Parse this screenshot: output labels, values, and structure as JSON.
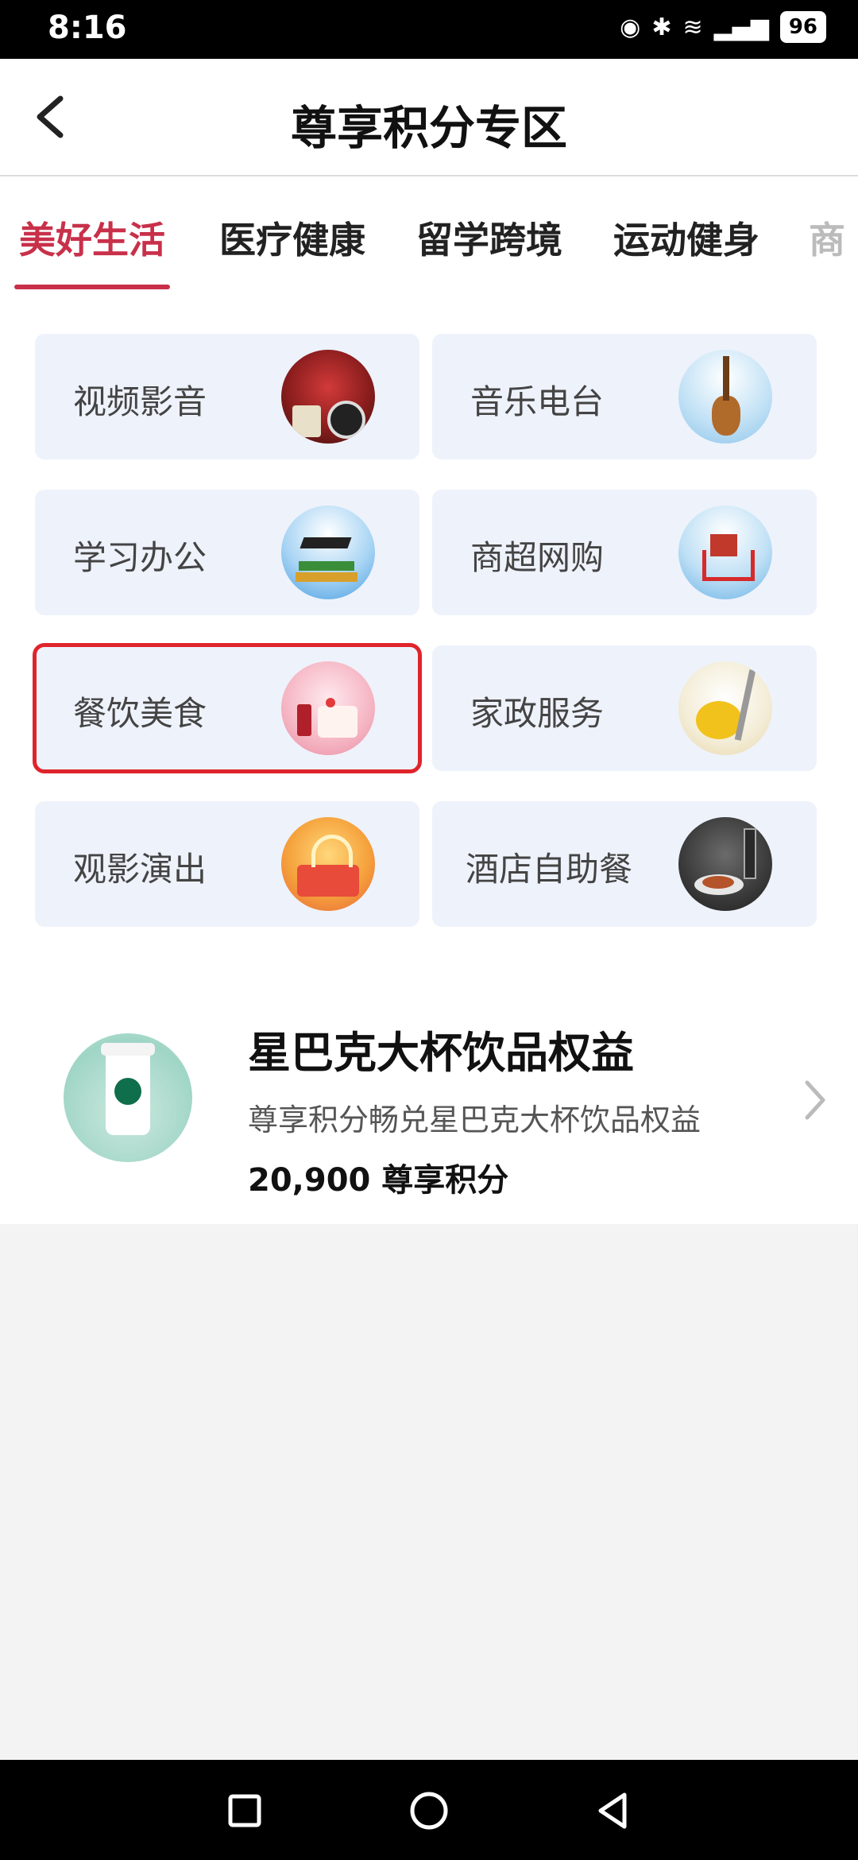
{
  "status_bar": {
    "time": "8:16",
    "battery": "96"
  },
  "header": {
    "title": "尊享积分专区"
  },
  "tabs": [
    {
      "label": "美好生活"
    },
    {
      "label": "医疗健康"
    },
    {
      "label": "留学跨境"
    },
    {
      "label": "运动健身"
    },
    {
      "label": "商"
    }
  ],
  "categories": [
    {
      "label": "视频影音",
      "icon": "cinema-icon"
    },
    {
      "label": "音乐电台",
      "icon": "guitar-icon"
    },
    {
      "label": "学习办公",
      "icon": "graduation-books-icon"
    },
    {
      "label": "商超网购",
      "icon": "shopping-cart-icon"
    },
    {
      "label": "餐饮美食",
      "icon": "cake-icon"
    },
    {
      "label": "家政服务",
      "icon": "vacuum-icon"
    },
    {
      "label": "观影演出",
      "icon": "stage-show-icon"
    },
    {
      "label": "酒店自助餐",
      "icon": "hotel-buffet-icon"
    }
  ],
  "product": {
    "title": "星巴克大杯饮品权益",
    "description": "尊享积分畅兑星巴克大杯饮品权益",
    "points": "20,900 尊享积分"
  },
  "colors": {
    "accent": "#c8304a",
    "selection_outline": "#e0242b",
    "card_bg": "#eef2fb"
  }
}
